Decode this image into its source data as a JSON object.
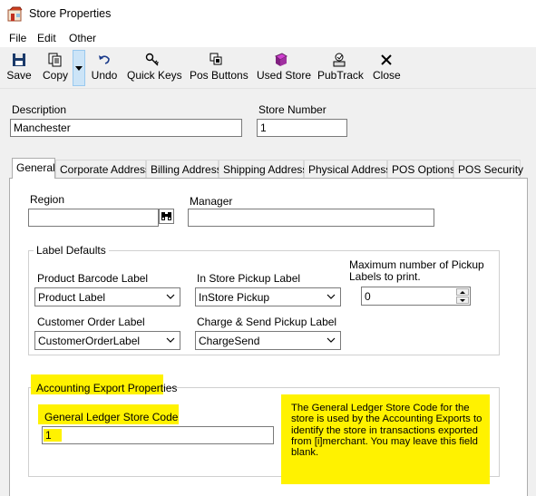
{
  "window": {
    "title": "Store Properties"
  },
  "menu": [
    "File",
    "Edit",
    "Other"
  ],
  "toolbar": {
    "save": "Save",
    "copy": "Copy",
    "undo": "Undo",
    "quick_keys": "Quick Keys",
    "pos_buttons": "Pos Buttons",
    "used_store": "Used Store",
    "pubtrack": "PubTrack",
    "close": "Close"
  },
  "header": {
    "description_label": "Description",
    "description_value": "Manchester",
    "store_number_label": "Store Number",
    "store_number_value": "1"
  },
  "tabs": [
    "General",
    "Corporate Address",
    "Billing Address",
    "Shipping Address",
    "Physical Address",
    "POS Options",
    "POS Security"
  ],
  "general": {
    "region_label": "Region",
    "region_value": "",
    "manager_label": "Manager",
    "manager_value": ""
  },
  "label_defaults": {
    "title": "Label Defaults",
    "product_barcode_label": "Product Barcode Label",
    "product_barcode_value": "Product Label",
    "in_store_pickup_label": "In Store Pickup Label",
    "in_store_pickup_value": "InStore Pickup",
    "max_pickup_label_line1": "Maximum number of Pickup",
    "max_pickup_label_line2": "Labels to print.",
    "max_pickup_value": "0",
    "customer_order_label": "Customer Order Label",
    "customer_order_value": "CustomerOrderLabel",
    "charge_send_label": "Charge & Send Pickup Label",
    "charge_send_value": "ChargeSend"
  },
  "accounting": {
    "title": "Accounting Export Properties",
    "gl_code_label": "General Ledger Store Code",
    "gl_code_value": "1",
    "note_lines": [
      "The General Ledger Store Code for the",
      "store is used by the Accounting Exports to",
      "identify the store in transactions exported",
      "from [i]merchant.  You may leave this field",
      "blank."
    ]
  },
  "colors": {
    "highlight": "#fff200",
    "accent": "#0078d7"
  }
}
